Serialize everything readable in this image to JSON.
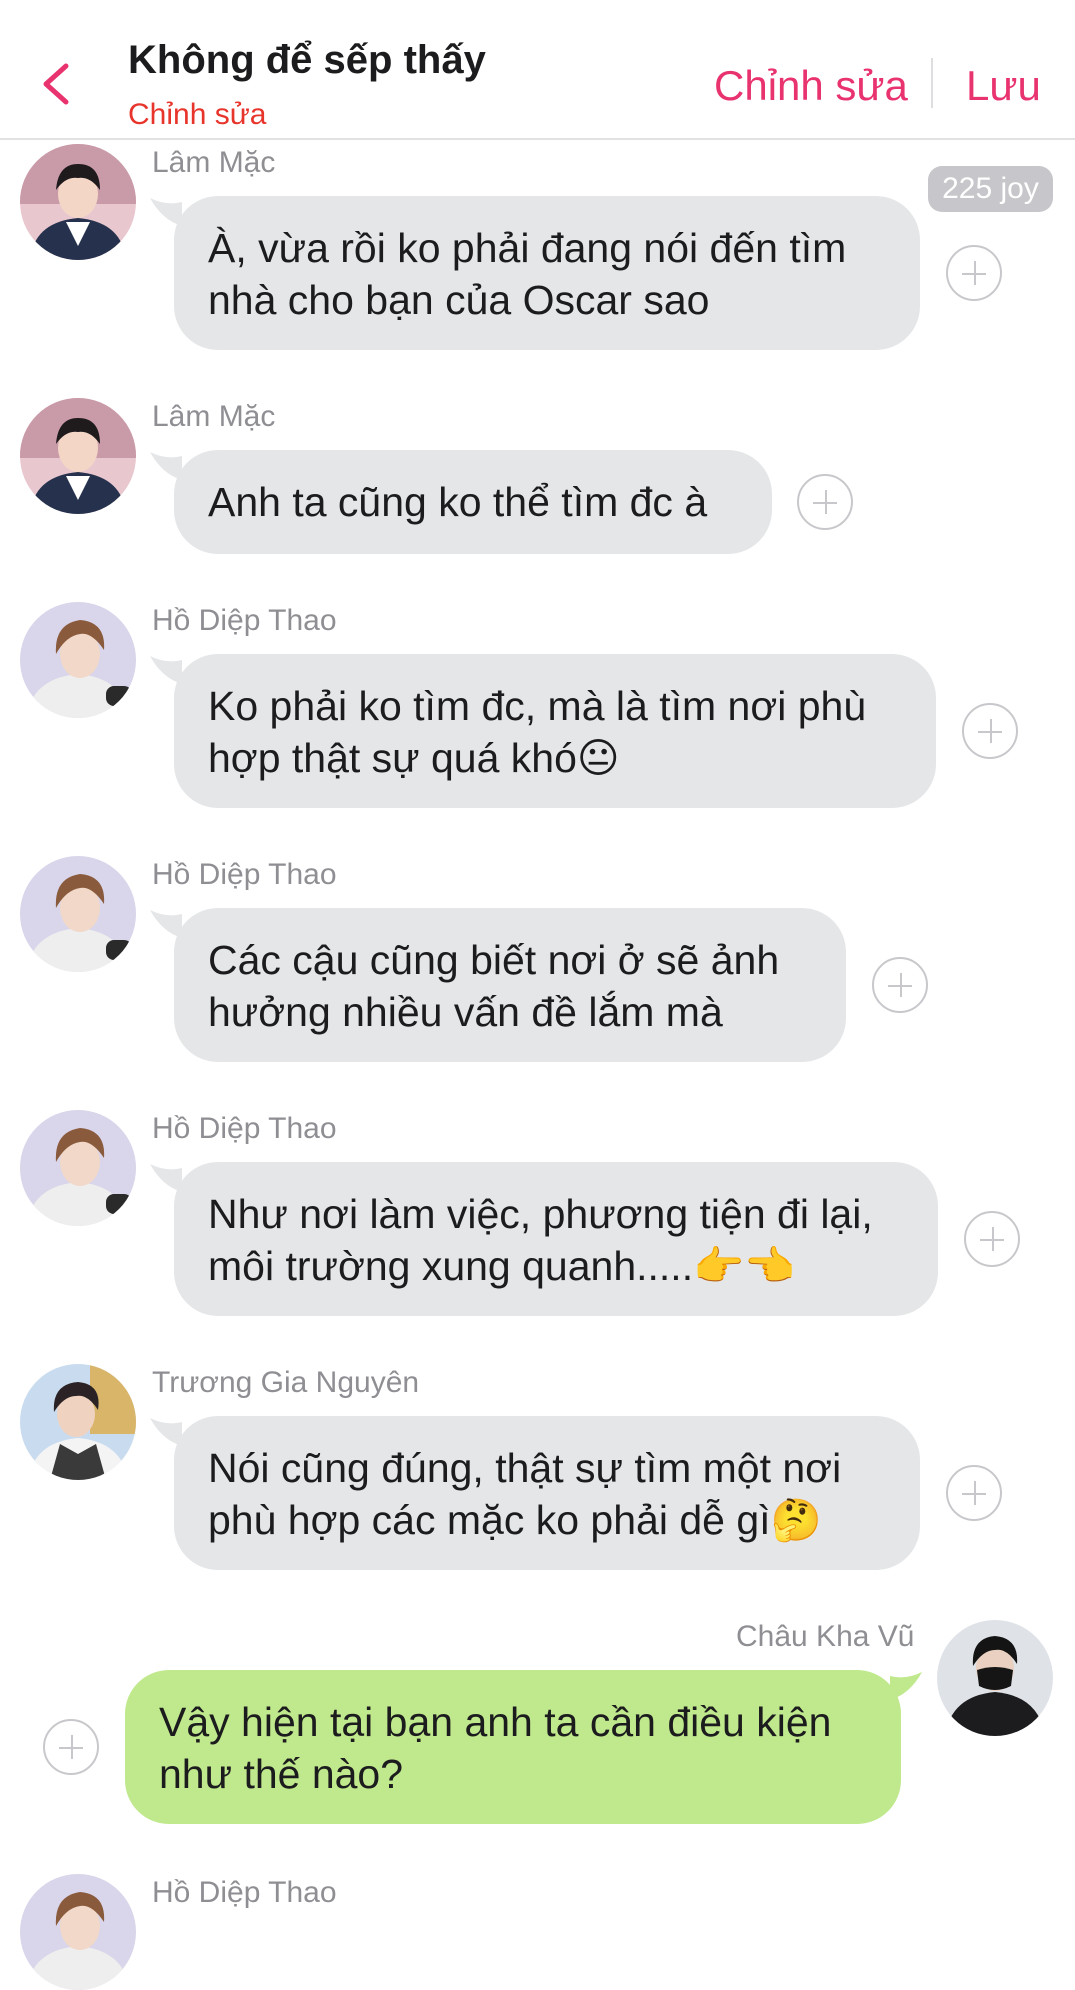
{
  "header": {
    "title": "Không để sếp thấy",
    "subtitle": "Chỉnh sửa",
    "edit_label": "Chỉnh sửa",
    "save_label": "Lưu",
    "back_icon": "chevron-left-icon",
    "accent_color": "#e8336f"
  },
  "badge": {
    "text": "225 joy"
  },
  "messages": [
    {
      "sender": "Lâm Mặc",
      "text": "À, vừa rồi ko phải đang nói đến tìm\nnhà cho bạn của Oscar sao",
      "side": "left"
    },
    {
      "sender": "Lâm Mặc",
      "text": "Anh ta cũng ko thể tìm đc à",
      "side": "left"
    },
    {
      "sender": "Hồ Diệp Thao",
      "text": "Ko phải ko tìm đc, mà là tìm nơi phù\nhợp thật sự quá khó😐",
      "side": "left"
    },
    {
      "sender": "Hồ Diệp Thao",
      "text": "Các cậu cũng biết nơi ở sẽ ảnh\nhưởng nhiều vấn đề lắm mà",
      "side": "left"
    },
    {
      "sender": "Hồ Diệp Thao",
      "text": "Như nơi làm việc, phương tiện đi lại,\nmôi trường xung quanh.....👉👈",
      "side": "left"
    },
    {
      "sender": "Trương Gia Nguyên",
      "text": "Nói cũng đúng, thật sự tìm một nơi\nphù hợp các mặc ko phải dễ gì🤔",
      "side": "left"
    },
    {
      "sender": "Châu Kha Vũ",
      "text": "Vậy hiện tại bạn anh ta cần điều kiện\nnhư thế nào?",
      "side": "right"
    },
    {
      "sender": "Hồ Diệp Thao",
      "text": "",
      "side": "left"
    }
  ],
  "colors": {
    "incoming_bubble": "#e4e6e8",
    "outgoing_bubble": "#bfe98c",
    "sender_name": "#8e8e93"
  },
  "icons": {
    "add": "add-circle-icon"
  }
}
